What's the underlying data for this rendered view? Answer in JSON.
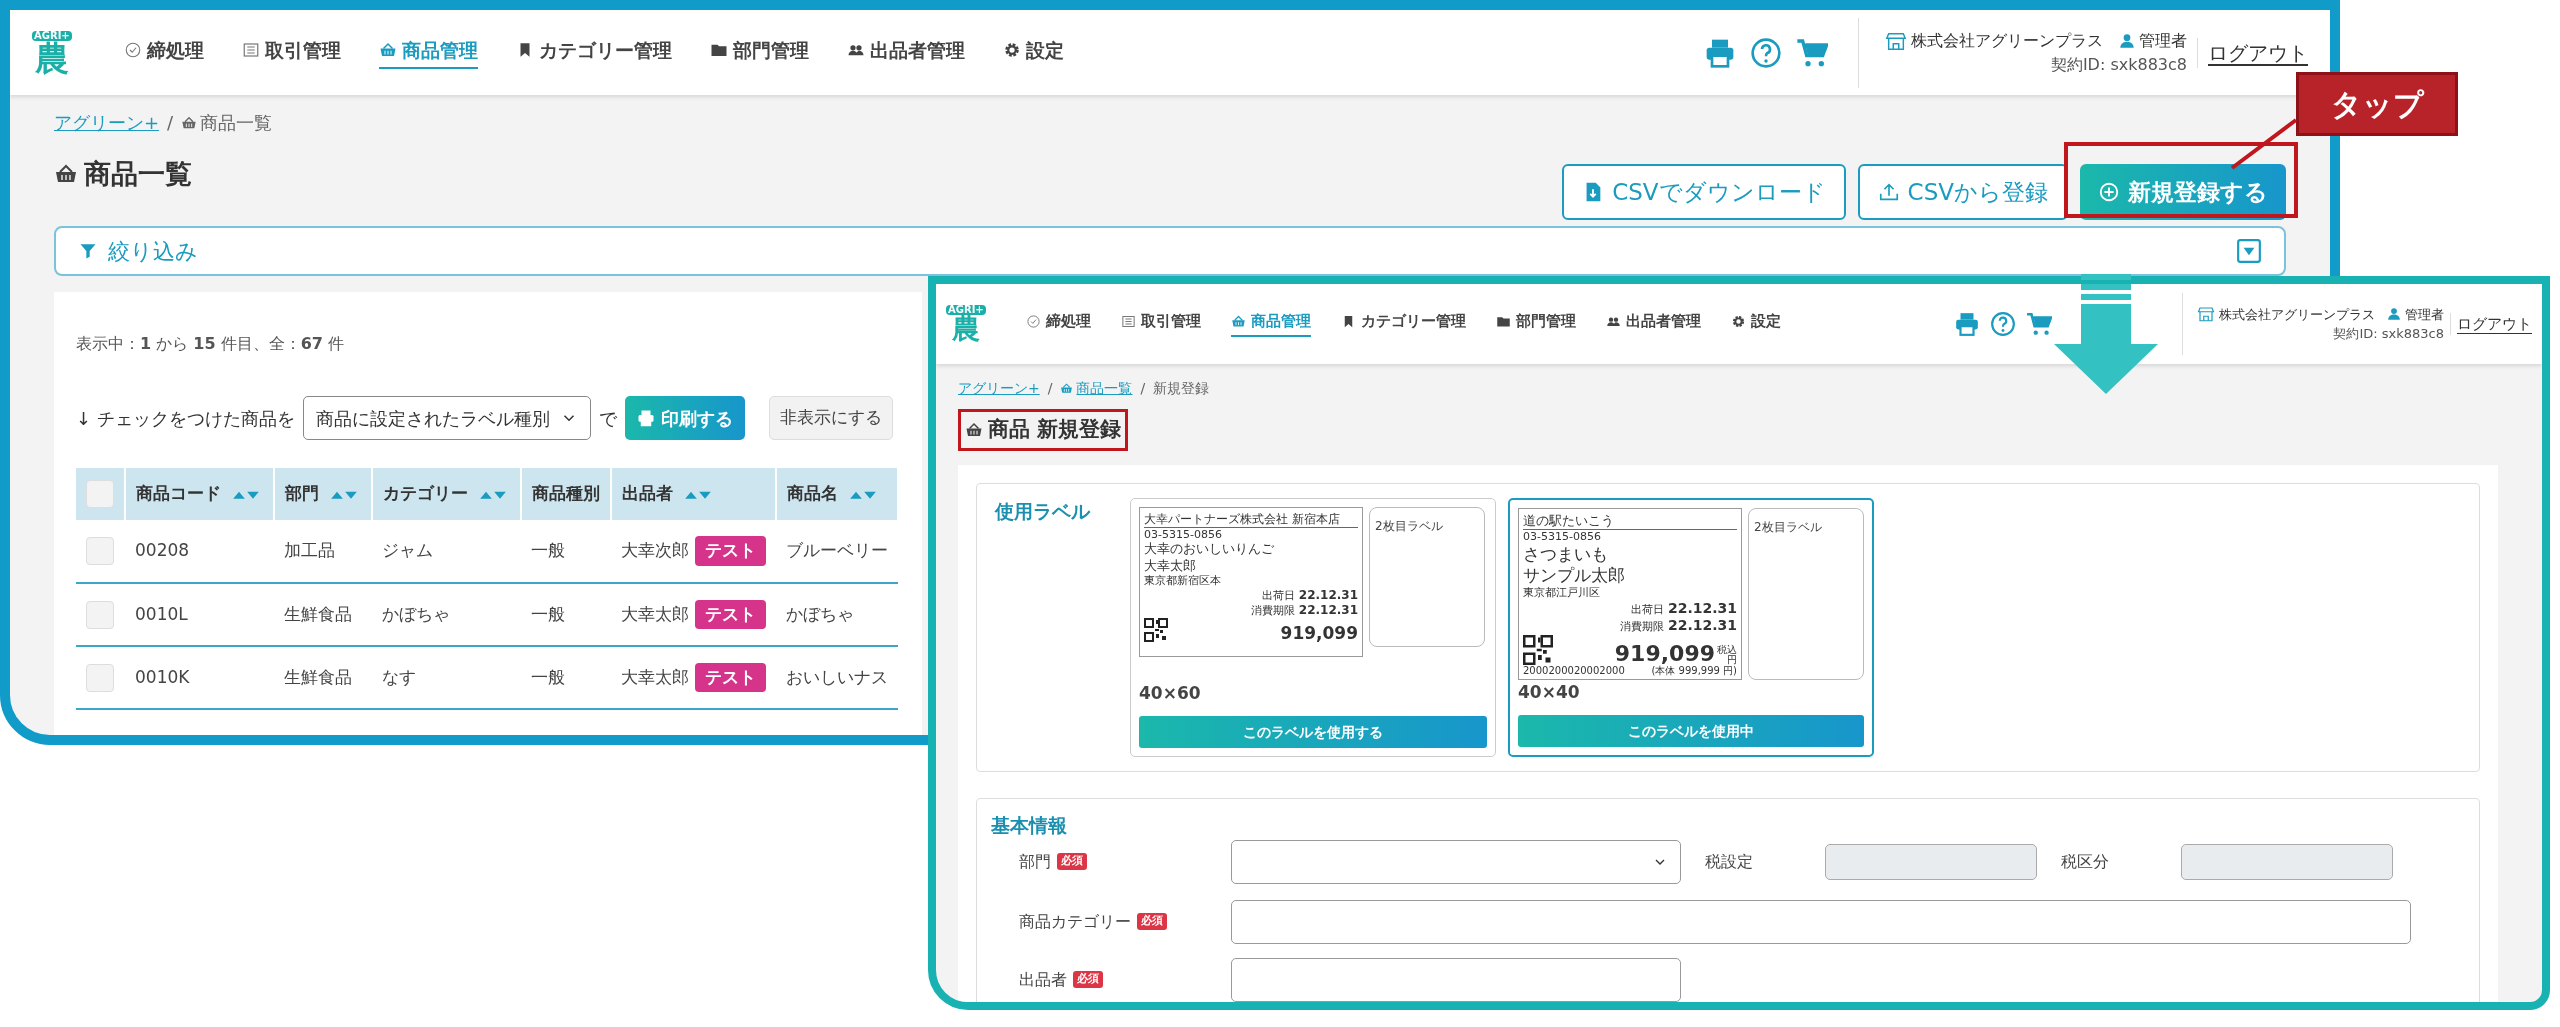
{
  "back_window": {
    "logo": {
      "badge": "AGRI+",
      "glyph": "農"
    },
    "nav": [
      {
        "label": "締処理",
        "selected": false
      },
      {
        "label": "取引管理",
        "selected": false
      },
      {
        "label": "商品管理",
        "selected": true
      },
      {
        "label": "カテゴリー管理",
        "selected": false
      },
      {
        "label": "部門管理",
        "selected": false
      },
      {
        "label": "出品者管理",
        "selected": false
      },
      {
        "label": "設定",
        "selected": false
      }
    ],
    "account": {
      "company": "株式会社アグリーンプラス",
      "role": "管理者",
      "contract": "契約ID: sxk883c8",
      "logout": "ログアウト"
    },
    "breadcrumb": [
      {
        "label": "アグリーン+",
        "link": true
      },
      {
        "separator": "/",
        "label": "商品一覧",
        "link": false
      }
    ],
    "title": "商品一覧",
    "actions": [
      {
        "label": "CSVでダウンロード",
        "kind": "outline"
      },
      {
        "label": "CSVから登録",
        "kind": "outline"
      },
      {
        "label": "新規登録する",
        "kind": "primary"
      }
    ],
    "filter": {
      "label": "絞り込み",
      "expanded": false
    },
    "summary": "表示中：**1** から **15** 件目、全：**67** 件",
    "bulk": {
      "prefix": "↓ チェックをつけた商品を",
      "select": "商品に設定されたラベル種別",
      "suffix": "で",
      "print": "印刷する",
      "hide": "非表示にする"
    },
    "table": {
      "select_all_checked": false,
      "columns": [
        {
          "label": "商品コード",
          "sortable": true
        },
        {
          "label": "部門",
          "sortable": true
        },
        {
          "label": "カテゴリー",
          "sortable": true
        },
        {
          "label": "商品種別",
          "sortable": false
        },
        {
          "label": "出品者",
          "sortable": true
        },
        {
          "label": "商品名",
          "sortable": true
        }
      ],
      "rows": [
        {
          "checked": false,
          "cells": [
            "00208",
            "加工品",
            "ジャム",
            "一般",
            "大幸次郎",
            "ブルーベリー"
          ],
          "tag": "テスト"
        },
        {
          "checked": false,
          "cells": [
            "0010L",
            "生鮮食品",
            "かぼちゃ",
            "一般",
            "大幸太郎",
            "かぼちゃ"
          ],
          "tag": "テスト"
        },
        {
          "checked": false,
          "cells": [
            "0010K",
            "生鮮食品",
            "なす",
            "一般",
            "大幸太郎",
            "おいしいナス"
          ],
          "tag": "テスト"
        }
      ]
    }
  },
  "callout": {
    "label": "タップ"
  },
  "front_window": {
    "logo": {
      "badge": "AGRI+",
      "glyph": "農"
    },
    "nav": [
      {
        "label": "締処理",
        "selected": false
      },
      {
        "label": "取引管理",
        "selected": false
      },
      {
        "label": "商品管理",
        "selected": true
      },
      {
        "label": "カテゴリー管理",
        "selected": false
      },
      {
        "label": "部門管理",
        "selected": false
      },
      {
        "label": "出品者管理",
        "selected": false
      },
      {
        "label": "設定",
        "selected": false
      }
    ],
    "account": {
      "company": "株式会社アグリーンプラス",
      "role": "管理者",
      "contract": "契約ID: sxk883c8",
      "logout": "ログアウト"
    },
    "breadcrumb": [
      {
        "label": "アグリーン+",
        "link": true
      },
      {
        "separator": "/",
        "label": "商品一覧",
        "link": true
      },
      {
        "separator": "/",
        "label": "新規登録",
        "link": false
      }
    ],
    "title": "商品 新規登録",
    "label_section": {
      "heading": "使用ラベル",
      "cards": [
        {
          "selected": false,
          "size": "40×60",
          "button": "このラベルを使用する",
          "preview": {
            "lines": [
              {
                "kind": "header",
                "text": "大幸パートナーズ株式会社 新宿本店"
              },
              {
                "kind": "phone",
                "text": "03-5315-0856"
              },
              {
                "kind": "title",
                "text": "大幸のおいしいりんご"
              },
              {
                "kind": "title",
                "text": "大幸太郎"
              },
              {
                "kind": "body",
                "text": "東京都新宿区本"
              },
              {
                "kind": "date",
                "label": "出荷日",
                "text": "22.12.31"
              },
              {
                "kind": "date",
                "label": "消費期限",
                "text": "22.12.31"
              },
              {
                "kind": "price",
                "text": "919,099"
              }
            ],
            "second": "2枚目ラベル"
          }
        },
        {
          "selected": true,
          "size": "40×40",
          "button": "このラベルを使用中",
          "preview": {
            "lines": [
              {
                "kind": "header",
                "text": "道の駅たいこう"
              },
              {
                "kind": "phone",
                "text": "03-5315-0856"
              },
              {
                "kind": "title",
                "text": "さつまいも"
              },
              {
                "kind": "title",
                "text": "サンプル太郎"
              },
              {
                "kind": "body",
                "text": "東京都江戸川区"
              },
              {
                "kind": "date",
                "label": "出荷日",
                "text": "22.12.31"
              },
              {
                "kind": "date",
                "label": "消費期限",
                "text": "22.12.31"
              },
              {
                "kind": "price",
                "text": "919,099",
                "suffix_top": "税込",
                "suffix_bottom": "円"
              },
              {
                "kind": "code",
                "text": "2000200020002000",
                "note": "(本体 999,999 円)"
              }
            ],
            "second": "2枚目ラベル"
          }
        }
      ]
    },
    "basic_info": {
      "heading": "基本情報",
      "department": {
        "label": "部門",
        "badge": "必須"
      },
      "tax_setting": {
        "label": "税設定"
      },
      "tax_class": {
        "label": "税区分"
      },
      "category": {
        "label": "商品カテゴリー",
        "badge": "必須"
      },
      "seller": {
        "label": "出品者",
        "badge": "必須"
      }
    }
  }
}
